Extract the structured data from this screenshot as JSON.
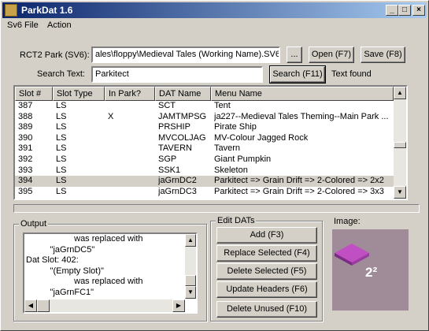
{
  "window": {
    "title": "ParkDat 1.6",
    "buttons": {
      "minimize": "_",
      "maximize": "□",
      "close": "×"
    }
  },
  "menu": [
    {
      "label": "Sv6 File"
    },
    {
      "label": "Action"
    }
  ],
  "park": {
    "label": "RCT2 Park (SV6):",
    "value": "ales\\floppy\\Medieval Tales (Working Name).SV6",
    "browse_label": "...",
    "open_label": "Open (F7)",
    "save_label": "Save (F8)"
  },
  "search": {
    "label": "Search Text:",
    "value": "Parkitect",
    "button_label": "Search (F11)",
    "status": "Text found"
  },
  "list": {
    "columns": [
      "Slot #",
      "Slot Type",
      "In Park?",
      "DAT Name",
      "Menu Name"
    ],
    "rows": [
      {
        "slot": "387",
        "type": "LS",
        "in_park": "",
        "dat": "SCT",
        "menu": "Tent"
      },
      {
        "slot": "388",
        "type": "LS",
        "in_park": "X",
        "dat": "JAMTMPSG",
        "menu": "ja227--Medieval Tales Theming--Main Park ..."
      },
      {
        "slot": "389",
        "type": "LS",
        "in_park": "",
        "dat": "PRSHIP",
        "menu": "Pirate Ship"
      },
      {
        "slot": "390",
        "type": "LS",
        "in_park": "",
        "dat": "MVCOLJAG",
        "menu": "MV-Colour Jagged Rock"
      },
      {
        "slot": "391",
        "type": "LS",
        "in_park": "",
        "dat": "TAVERN",
        "menu": "Tavern"
      },
      {
        "slot": "392",
        "type": "LS",
        "in_park": "",
        "dat": "SGP",
        "menu": "Giant Pumpkin"
      },
      {
        "slot": "393",
        "type": "LS",
        "in_park": "",
        "dat": "SSK1",
        "menu": "Skeleton"
      },
      {
        "slot": "394",
        "type": "LS",
        "in_park": "",
        "dat": "jaGrnDC2",
        "menu": "Parkitect => Grain Drift => 2-Colored => 2x2",
        "selected": true
      },
      {
        "slot": "395",
        "type": "LS",
        "in_park": "",
        "dat": "jaGrnDC3",
        "menu": "Parkitect => Grain Drift => 2-Colored => 3x3"
      }
    ]
  },
  "output": {
    "title": "Output",
    "lines": [
      "                    was replaced with",
      "          \"jaGrnDC5\"",
      "Dat Slot: 402:",
      "          \"(Empty Slot)\"",
      "                    was replaced with",
      "          \"jaGrnFC1\""
    ]
  },
  "edit_dats": {
    "title": "Edit DATs",
    "buttons": [
      "Add (F3)",
      "Replace Selected  (F4)",
      "Delete Selected  (F5)",
      "Update Headers  (F6)",
      "Delete Unused (F10)"
    ]
  },
  "image": {
    "label": "Image:",
    "preview_badge": "2²"
  },
  "colors": {
    "title_start": "#0a246a",
    "title_end": "#a6caf0",
    "face": "#d4d0c8",
    "preview_bg": "#a08c99",
    "preview_tile": "#b03cb8"
  }
}
